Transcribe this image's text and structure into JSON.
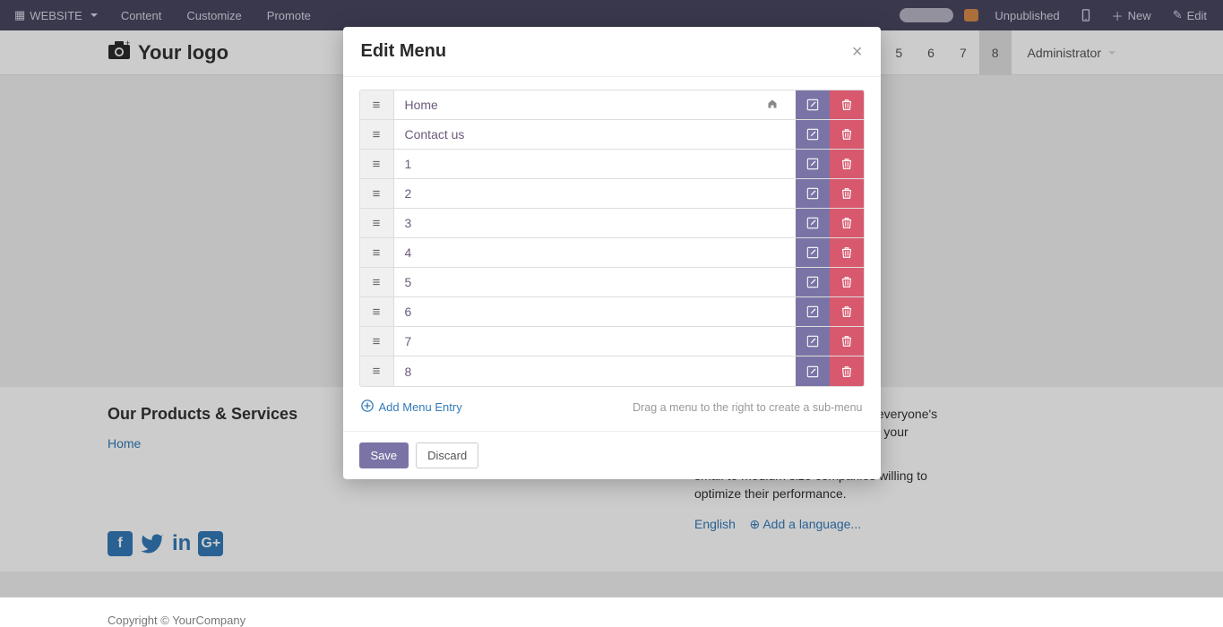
{
  "topbar": {
    "brand": "WEBSITE",
    "links": [
      "Content",
      "Customize",
      "Promote"
    ],
    "unpublished": "Unpublished",
    "new": "New",
    "edit": "Edit"
  },
  "header": {
    "logo_text": "Your logo",
    "tabs": [
      "5",
      "6",
      "7",
      "8"
    ],
    "active_tab_index": 3,
    "admin": "Administrator"
  },
  "footer": {
    "products_heading": "Our Products & Services",
    "home_link": "Home",
    "about_1": "people whose goal is to improve everyone's",
    "about_2": ". We build great products to solve your",
    "about_3": "small to medium size companies willing to",
    "about_4": "optimize their performance.",
    "language": "English",
    "add_language": "Add a language...",
    "copyright": "Copyright © YourCompany"
  },
  "modal": {
    "title": "Edit Menu",
    "items": [
      {
        "label": "Home",
        "is_home": true
      },
      {
        "label": "Contact us",
        "is_home": false
      },
      {
        "label": "1",
        "is_home": false
      },
      {
        "label": "2",
        "is_home": false
      },
      {
        "label": "3",
        "is_home": false
      },
      {
        "label": "4",
        "is_home": false
      },
      {
        "label": "5",
        "is_home": false
      },
      {
        "label": "6",
        "is_home": false
      },
      {
        "label": "7",
        "is_home": false
      },
      {
        "label": "8",
        "is_home": false
      }
    ],
    "add_entry": "Add Menu Entry",
    "hint": "Drag a menu to the right to create a sub-menu",
    "save": "Save",
    "discard": "Discard"
  }
}
